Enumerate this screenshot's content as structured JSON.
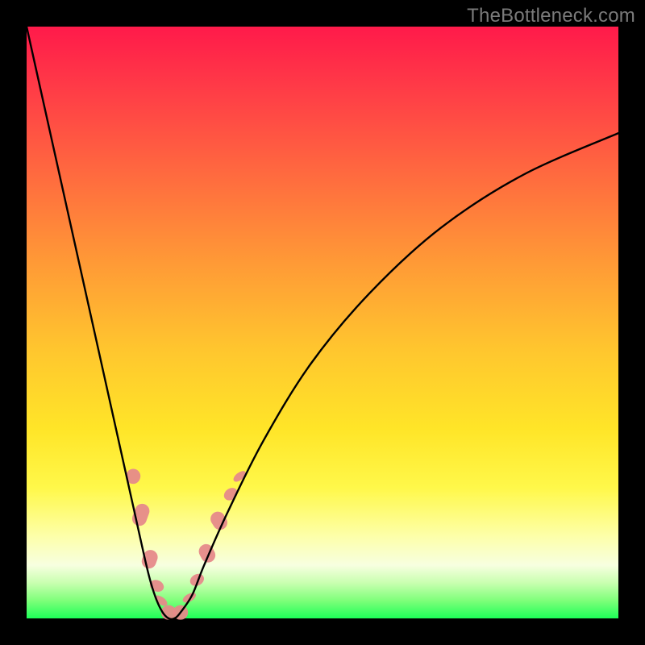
{
  "watermark": "TheBottleneck.com",
  "chart_data": {
    "type": "line",
    "title": "",
    "xlabel": "",
    "ylabel": "",
    "xlim": [
      0,
      100
    ],
    "ylim": [
      0,
      100
    ],
    "series": [
      {
        "name": "curve",
        "x": [
          0,
          4,
          8,
          12,
          16,
          18,
          20,
          21,
          22,
          23,
          24,
          25,
          26,
          28,
          30,
          34,
          40,
          48,
          58,
          70,
          84,
          100
        ],
        "y": [
          100,
          82,
          64,
          46,
          28,
          19,
          10,
          6,
          3,
          1,
          0,
          0,
          1,
          4,
          9,
          18,
          30,
          43,
          55,
          66,
          75,
          82
        ]
      }
    ],
    "markers": [
      {
        "name": "left-marker-1",
        "x": 18.0,
        "y": 24.0,
        "len": 4,
        "angle": -70
      },
      {
        "name": "left-marker-2",
        "x": 19.3,
        "y": 17.5,
        "len": 6,
        "angle": -70
      },
      {
        "name": "left-marker-3",
        "x": 20.8,
        "y": 10.0,
        "len": 5,
        "angle": -70
      },
      {
        "name": "left-marker-4",
        "x": 22.0,
        "y": 5.5,
        "len": 3,
        "angle": -65
      },
      {
        "name": "left-marker-5",
        "x": 22.7,
        "y": 3.0,
        "len": 2,
        "angle": -55
      },
      {
        "name": "bottom-marker-1",
        "x": 24.0,
        "y": 1.0,
        "len": 4,
        "angle": 0
      },
      {
        "name": "bottom-marker-2",
        "x": 26.0,
        "y": 1.0,
        "len": 4,
        "angle": 0
      },
      {
        "name": "right-marker-1",
        "x": 27.5,
        "y": 3.5,
        "len": 2,
        "angle": 60
      },
      {
        "name": "right-marker-2",
        "x": 28.8,
        "y": 6.5,
        "len": 3,
        "angle": 62
      },
      {
        "name": "right-marker-3",
        "x": 30.5,
        "y": 11.0,
        "len": 5,
        "angle": 62
      },
      {
        "name": "right-marker-4",
        "x": 32.5,
        "y": 16.5,
        "len": 5,
        "angle": 58
      },
      {
        "name": "right-marker-5",
        "x": 34.5,
        "y": 21.0,
        "len": 3,
        "angle": 55
      },
      {
        "name": "right-marker-6",
        "x": 36.0,
        "y": 24.0,
        "len": 2,
        "angle": 52
      }
    ],
    "colors": {
      "curve": "#000000",
      "marker": "#e68a8a",
      "gradient_top": "#ff1a4a",
      "gradient_bottom": "#1eff58"
    }
  }
}
